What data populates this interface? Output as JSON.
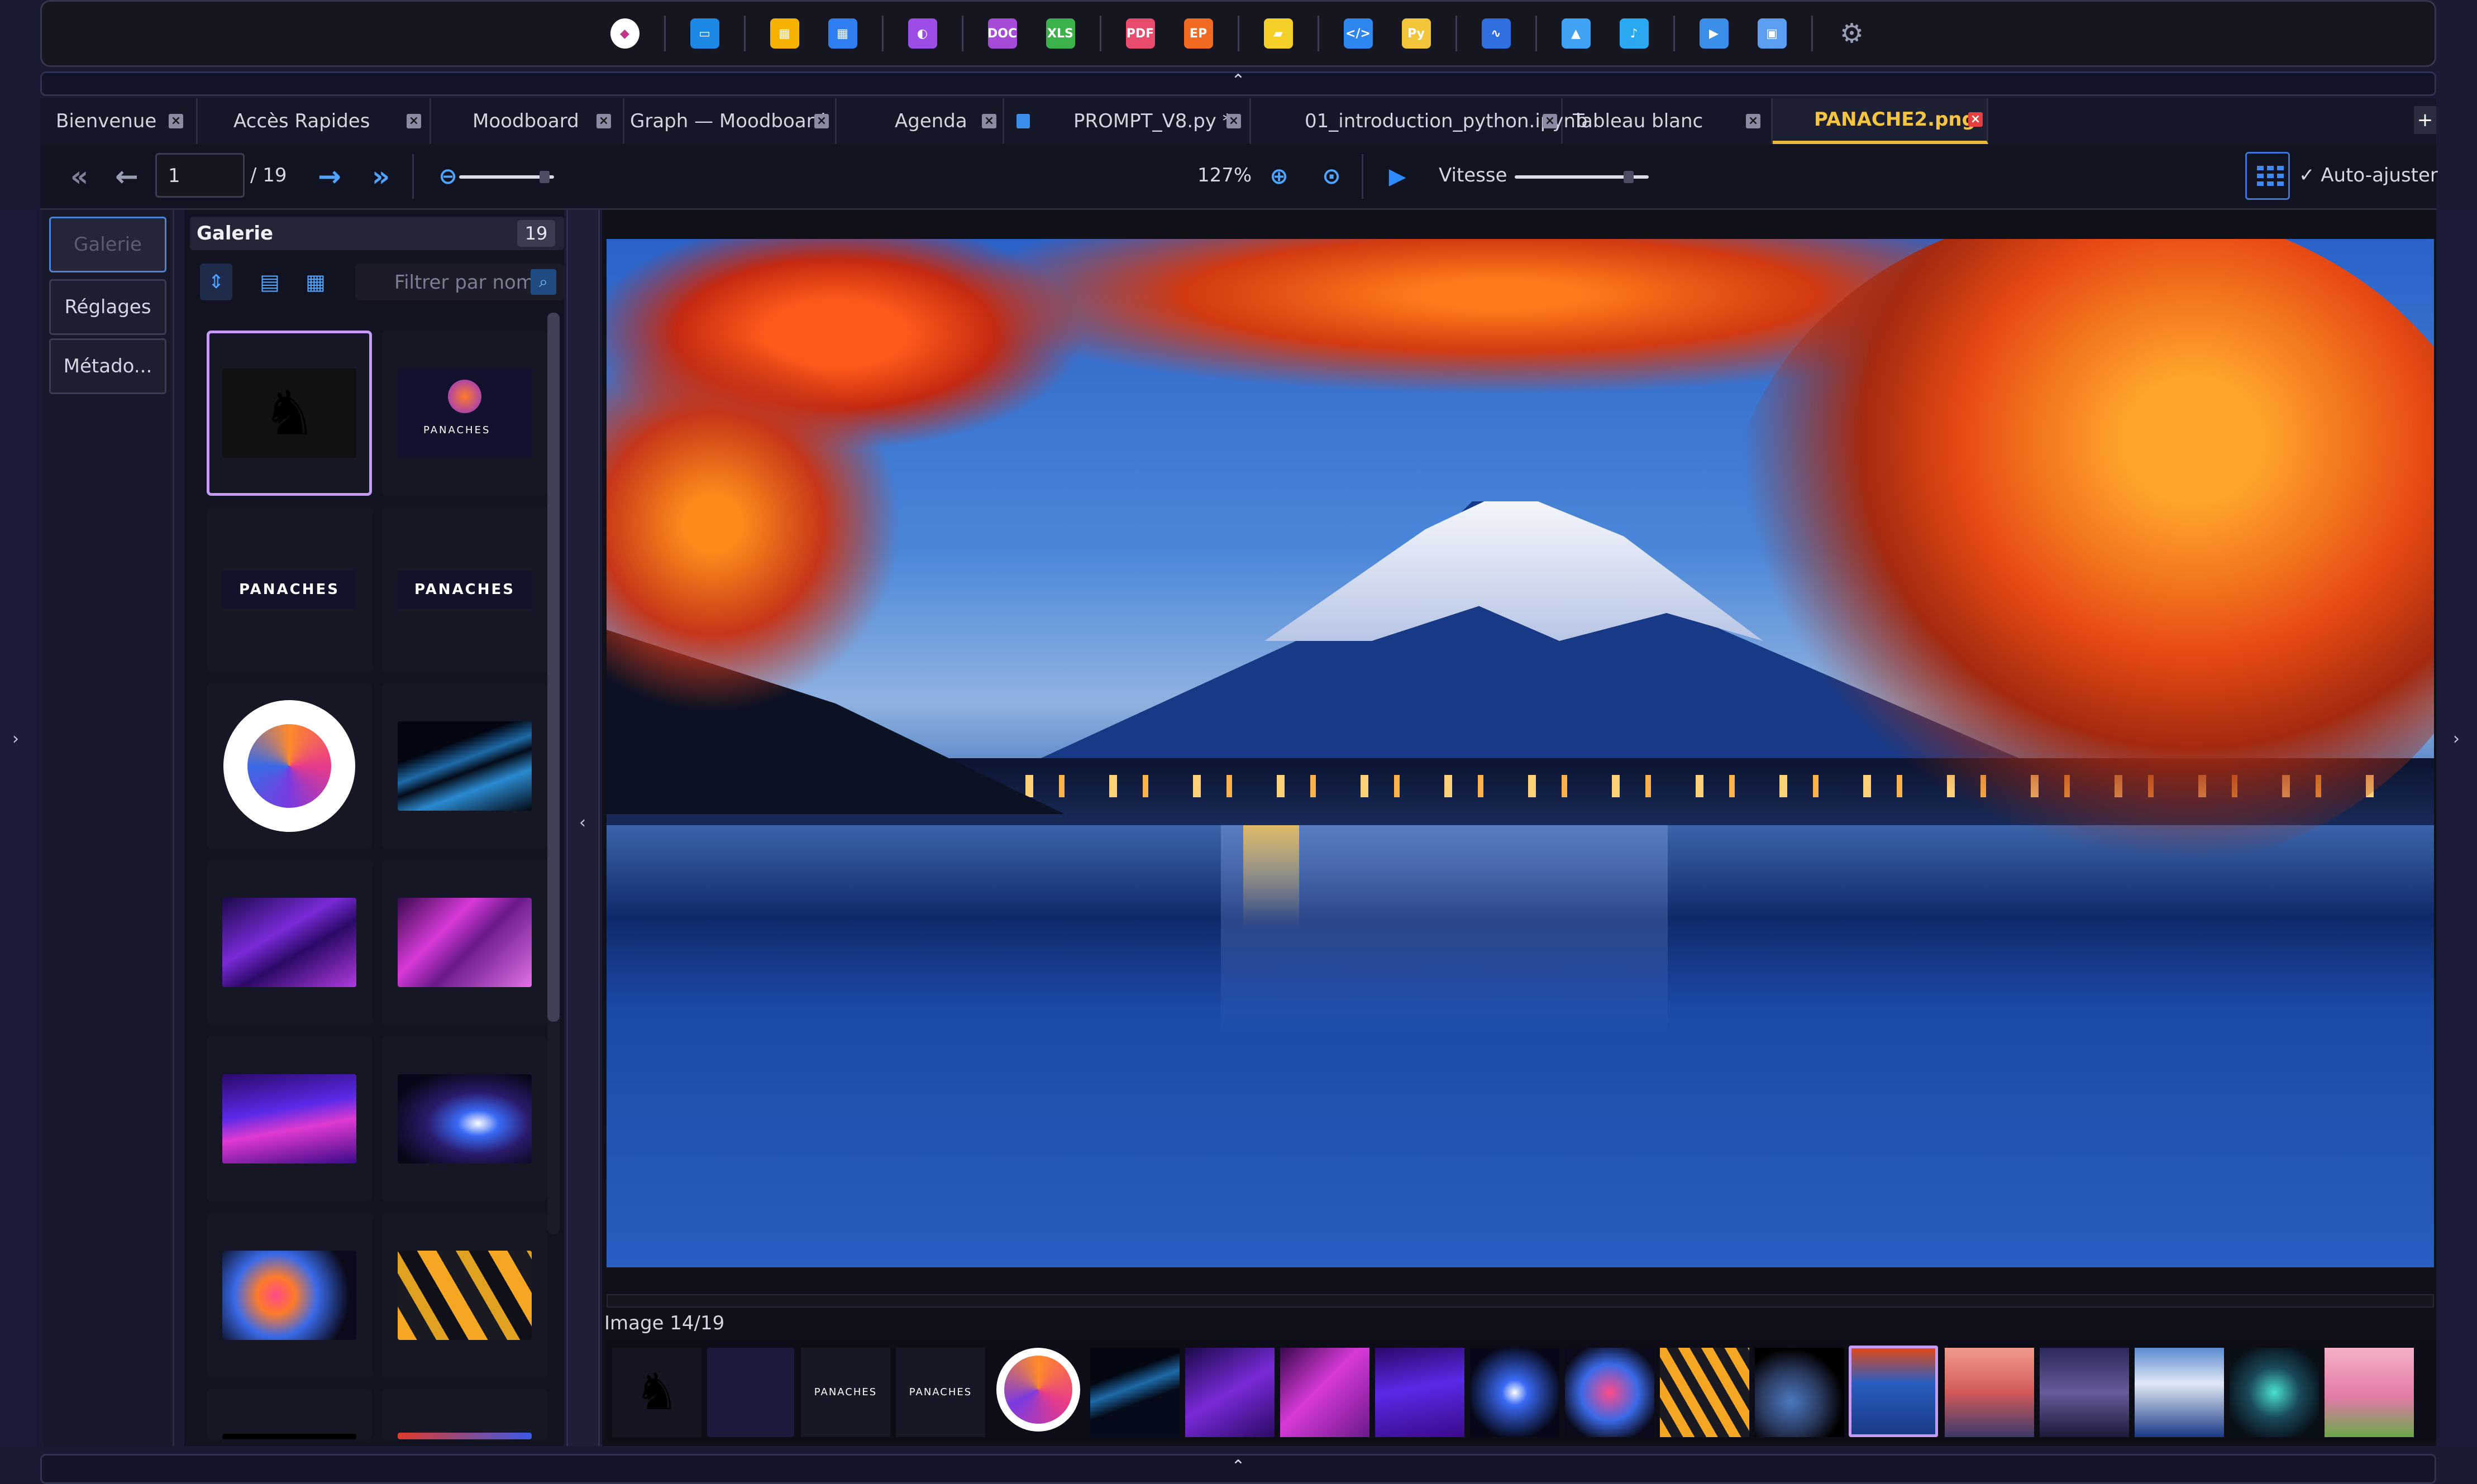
{
  "topbar": {
    "icons": [
      {
        "name": "app-logo-icon",
        "color": "#ffffff",
        "glyph": "◆"
      },
      {
        "name": "window-icon",
        "color": "#1e88e5",
        "glyph": "▭"
      },
      {
        "name": "moodboard-icon",
        "color": "#f5b300",
        "glyph": "▦"
      },
      {
        "name": "calendar-icon",
        "color": "#2f7ef2",
        "glyph": "▦"
      },
      {
        "name": "purple-file-icon",
        "color": "#9b4de6",
        "glyph": "◐"
      },
      {
        "name": "doc-file-icon",
        "color": "#a64bd8",
        "glyph": "DOC"
      },
      {
        "name": "xlsx-file-icon",
        "color": "#3bb24a",
        "glyph": "XLS"
      },
      {
        "name": "pdf-file-icon",
        "color": "#e84b6b",
        "glyph": "PDF"
      },
      {
        "name": "epub-file-icon",
        "color": "#f26a21",
        "glyph": "EP"
      },
      {
        "name": "sticky-note-icon",
        "color": "#f4d028",
        "glyph": "▰"
      },
      {
        "name": "code-file-icon",
        "color": "#2e86f0",
        "glyph": "</>"
      },
      {
        "name": "python-icon",
        "color": "#f3c53b",
        "glyph": "Py"
      },
      {
        "name": "whiteboard-icon",
        "color": "#2f6fe0",
        "glyph": "∿"
      },
      {
        "name": "image-viewer-icon",
        "color": "#3fa2f5",
        "glyph": "▲"
      },
      {
        "name": "audio-file-icon",
        "color": "#2aa8f2",
        "glyph": "♪"
      },
      {
        "name": "video-file-icon",
        "color": "#3b8fe8",
        "glyph": "▶"
      },
      {
        "name": "folder-icon",
        "color": "#5b9ef2",
        "glyph": "▣"
      },
      {
        "name": "settings-gear-icon",
        "color": "#9aa0b4",
        "glyph": "⚙"
      }
    ]
  },
  "tabs": [
    {
      "label": "Bienvenue"
    },
    {
      "label": "Accès Rapides"
    },
    {
      "label": "Moodboard"
    },
    {
      "label": "Graph — Moodboard"
    },
    {
      "label": "Agenda"
    },
    {
      "label": "PROMPT_V8.py *"
    },
    {
      "label": "01_introduction_python.ipynb"
    },
    {
      "label": "Tableau blanc"
    },
    {
      "label": "PANACHE2.png"
    }
  ],
  "toolbar": {
    "page_value": "1",
    "page_total": "/ 19",
    "zoom": "127%",
    "speed_label": "Vitesse",
    "autofit_label": "✓ Auto-ajuster",
    "zoom_slider_level": 0.9,
    "speed_slider_level": 0.85
  },
  "side": {
    "items": [
      {
        "label": "Galerie"
      },
      {
        "label": "Réglages"
      },
      {
        "label": "Métado..."
      }
    ]
  },
  "gallery": {
    "title": "Galerie",
    "count": "19",
    "filter_placeholder": "Filtrer par nom",
    "logo_text": "PANACHES"
  },
  "viewer": {
    "status": "Image 14/19",
    "colors": {
      "accent": "#4ea4ff",
      "selection": "#c59bf5",
      "active_tab": "#f5c542"
    }
  }
}
